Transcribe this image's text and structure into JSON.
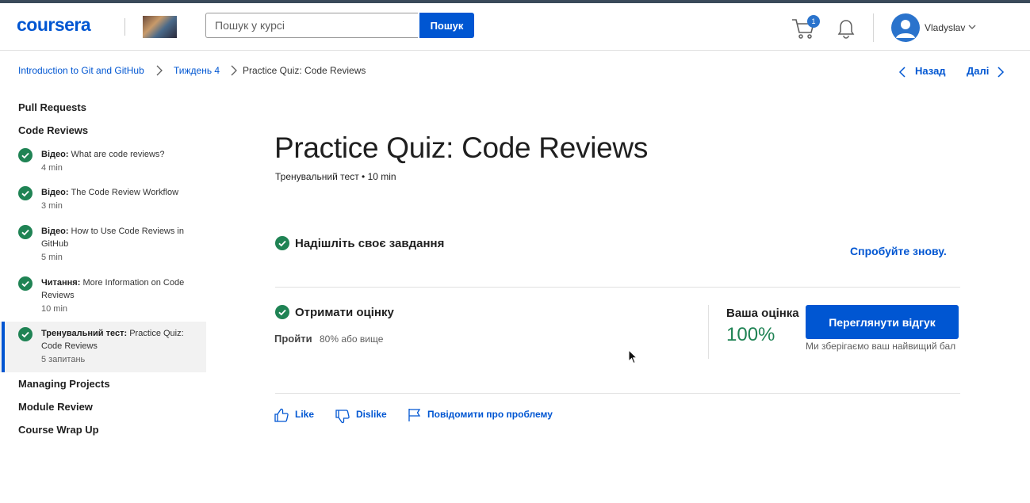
{
  "header": {
    "logo": "coursera",
    "search_placeholder": "Пошук у курсі",
    "search_button": "Пошук",
    "cart_count": "1",
    "user_name": "Vladyslav"
  },
  "breadcrumb": {
    "course": "Introduction to Git and GitHub",
    "week": "Тиждень 4",
    "current": "Practice Quiz: Code Reviews"
  },
  "nav": {
    "prev": "Назад",
    "next": "Далі"
  },
  "sidebar": {
    "sections_top": [
      "Pull Requests",
      "Code Reviews"
    ],
    "items": [
      {
        "type": "Відео:",
        "title": "What are code reviews?",
        "meta": "4 min"
      },
      {
        "type": "Відео:",
        "title": "The Code Review Workflow",
        "meta": "3 min"
      },
      {
        "type": "Відео:",
        "title": "How to Use Code Reviews in GitHub",
        "meta": "5 min"
      },
      {
        "type": "Читання:",
        "title": "More Information on Code Reviews",
        "meta": "10 min"
      },
      {
        "type": "Тренувальний тест:",
        "title": "Practice Quiz: Code Reviews",
        "meta": "5 запитань"
      }
    ],
    "sections_bottom": [
      "Managing Projects",
      "Module Review",
      "Course Wrap Up"
    ]
  },
  "main": {
    "title": "Practice Quiz: Code Reviews",
    "subtitle": "Тренувальний тест • 10 min",
    "submit_title": "Надішліть своє завдання",
    "retry": "Спробуйте знову.",
    "grade_title": "Отримати оцінку",
    "pass_label": "Пройти",
    "pass_value": "80% або вище",
    "your_grade_label": "Ваша оцінка",
    "your_grade_value": "100%",
    "review_button": "Переглянути відгук",
    "keep_note": "Ми зберігаємо ваш найвищий бал"
  },
  "feedback": {
    "like": "Like",
    "dislike": "Dislike",
    "report": "Повідомити про проблему"
  },
  "colors": {
    "brand": "#0056d2",
    "success": "#1f8354"
  }
}
